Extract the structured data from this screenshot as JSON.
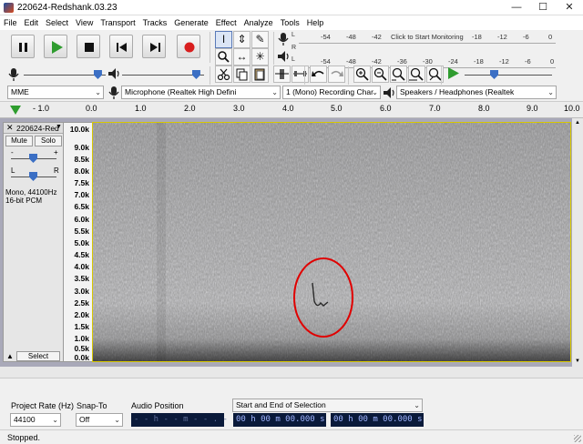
{
  "window": {
    "title": "220624-Redshank.03.23",
    "controls": {
      "minimize": "—",
      "maximize": "☐",
      "close": "✕"
    }
  },
  "menu": [
    "File",
    "Edit",
    "Select",
    "View",
    "Transport",
    "Tracks",
    "Generate",
    "Effect",
    "Analyze",
    "Tools",
    "Help"
  ],
  "transport": {
    "icons": [
      "pause-icon",
      "play-icon",
      "stop-icon",
      "skip-start-icon",
      "skip-end-icon",
      "record-icon"
    ],
    "colors": {
      "play": "#2f9c2f",
      "record": "#d81e1e"
    }
  },
  "tools": {
    "selection": "I",
    "envelope": "⇕",
    "draw": "✎",
    "zoom": "🔍",
    "timeshift": "↔",
    "multi": "✳"
  },
  "record_meter": {
    "left_channel": "L",
    "right_channel": "R",
    "ticks": [
      "-54",
      "-48",
      "-42",
      "-18",
      "-12",
      "-6",
      "0"
    ],
    "prompt": "Click to Start Monitoring"
  },
  "playback_meter": {
    "left_channel": "L",
    "right_channel": "R",
    "ticks": [
      "-54",
      "-48",
      "-42",
      "-36",
      "-30",
      "-24",
      "-18",
      "-12",
      "-6",
      "0"
    ]
  },
  "mixer": {
    "record_volume": 0.95,
    "playback_volume": 0.95
  },
  "edit_toolbar": {
    "icons": [
      "cut-icon",
      "copy-icon",
      "paste-icon",
      "trim-icon",
      "silence-icon",
      "undo-icon",
      "redo-icon",
      "zoom-in-icon",
      "zoom-out-icon",
      "fit-selection-icon",
      "fit-project-icon",
      "zoom-toggle-icon"
    ],
    "play_at_speed_icon": "play-at-speed-icon"
  },
  "device_toolbar": {
    "host": "MME",
    "mic_icon": "microphone-icon",
    "recording_device": "Microphone (Realtek High Defini",
    "channels": "1 (Mono) Recording Char",
    "speaker_icon": "speaker-icon",
    "playback_device": "Speakers / Headphones (Realtek"
  },
  "ruler": {
    "ticks": [
      "- 1.0",
      "0.0",
      "1.0",
      "2.0",
      "3.0",
      "4.0",
      "5.0",
      "6.0",
      "7.0",
      "8.0",
      "9.0",
      "10.0"
    ],
    "marker_color": "#2e9d2e"
  },
  "track": {
    "name": "220624-Red",
    "mute_label": "Mute",
    "solo_label": "Solo",
    "gain_minus": "-",
    "gain_plus": "+",
    "pan_left": "L",
    "pan_right": "R",
    "info_line1": "Mono, 44100Hz",
    "info_line2": "16-bit PCM",
    "select_label": "Select",
    "collapse_icon": "▲",
    "close_icon": "✕",
    "menu_arrow": "▼"
  },
  "freq_axis": [
    "10.0k",
    "9.0k",
    "8.5k",
    "8.0k",
    "7.5k",
    "7.0k",
    "6.5k",
    "6.0k",
    "5.5k",
    "5.0k",
    "4.5k",
    "4.0k",
    "3.5k",
    "3.0k",
    "2.5k",
    "2.0k",
    "1.5k",
    "1.0k",
    "0.5k",
    "0.0k"
  ],
  "annotation": {
    "circle_color": "#e00000"
  },
  "selection_bar": {
    "project_rate_label": "Project Rate (Hz)",
    "project_rate": "44100",
    "snap_to_label": "Snap-To",
    "snap_to": "Off",
    "audio_position_label": "Audio Position",
    "audio_position": "- - h - - m - - . - - - s",
    "selection_label": "Start and End of Selection",
    "selection_start": "00 h 00 m 00.000 s",
    "selection_end": "00 h 00 m 00.000 s"
  },
  "status": "Stopped."
}
